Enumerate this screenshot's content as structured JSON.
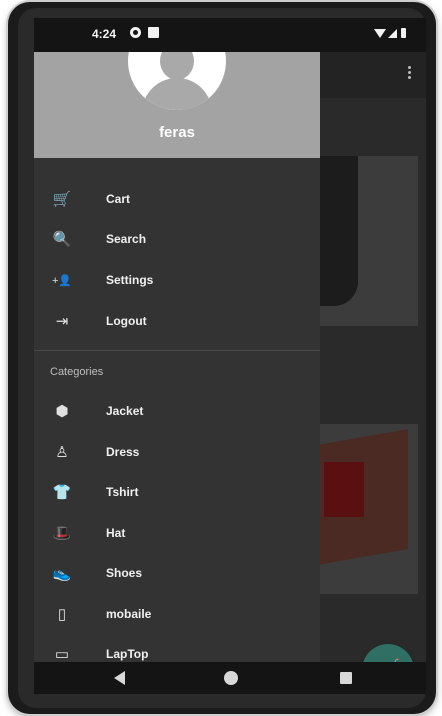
{
  "status_bar": {
    "time": "4:24",
    "icons": [
      "sync-icon",
      "sd-card-icon",
      "wifi-icon",
      "signal-icon",
      "battery-icon"
    ]
  },
  "drawer": {
    "user_name": "feras",
    "menu": [
      {
        "label": "Cart",
        "icon": "cart-icon",
        "glyph": "🛒"
      },
      {
        "label": "Search",
        "icon": "search-icon",
        "glyph": "🔍"
      },
      {
        "label": "Settings",
        "icon": "add-person-icon",
        "glyph": "+👤"
      },
      {
        "label": "Logout",
        "icon": "logout-icon",
        "glyph": "⇥"
      }
    ],
    "categories_title": "Categories",
    "categories": [
      {
        "label": "Jacket",
        "icon": "jacket-icon",
        "glyph": "⬢"
      },
      {
        "label": "Dress",
        "icon": "dress-icon",
        "glyph": "♙"
      },
      {
        "label": "Tshirt",
        "icon": "tshirt-icon",
        "glyph": "👕"
      },
      {
        "label": "Hat",
        "icon": "hat-icon",
        "glyph": "🎩"
      },
      {
        "label": "Shoes",
        "icon": "shoe-icon",
        "glyph": "👟"
      },
      {
        "label": "mobaile",
        "icon": "mobile-icon",
        "glyph": "▯"
      },
      {
        "label": "LapTop",
        "icon": "laptop-icon",
        "glyph": "▭"
      }
    ]
  },
  "fab": {
    "icon": "cart-icon",
    "glyph": "🛒"
  },
  "colors": {
    "drawer_bg": "#333333",
    "header_bg": "#a3a3a3",
    "fab_bg": "#2f6f64"
  }
}
